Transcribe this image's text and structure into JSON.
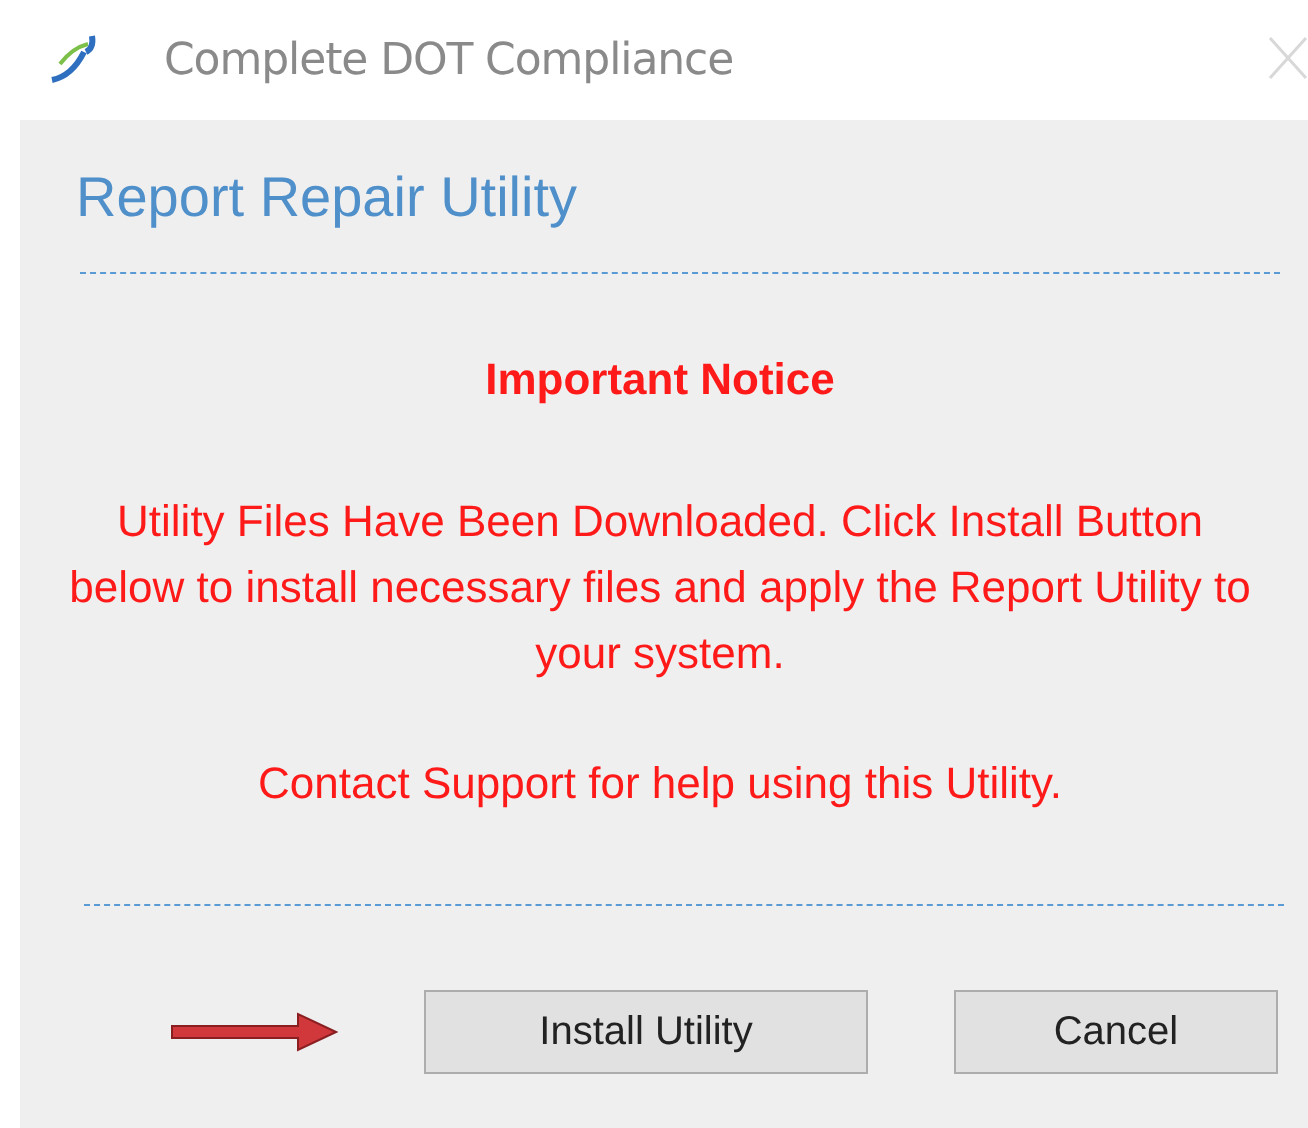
{
  "window": {
    "title": "Complete DOT Compliance"
  },
  "dialog": {
    "heading": "Report Repair Utility",
    "notice_title": "Important Notice",
    "paragraphs": [
      "Utility Files Have Been Downloaded.  Click Install Button below to install necessary files and apply the Report Utility to your system.",
      "Contact Support for help using this Utility."
    ],
    "buttons": [
      "Install Utility",
      "Cancel"
    ]
  }
}
